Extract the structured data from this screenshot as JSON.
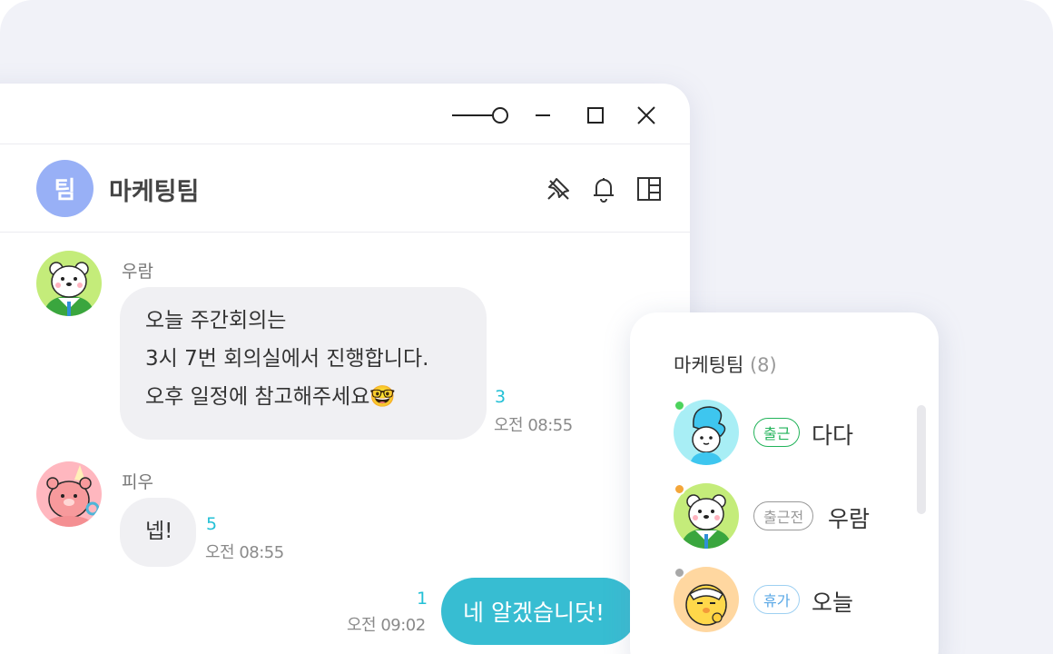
{
  "window_controls": {
    "slider_icon": "zoom-slider-icon",
    "minimize_icon": "minimize-icon",
    "maximize_icon": "maximize-icon",
    "close_icon": "close-icon"
  },
  "chat": {
    "avatar_text": "팀",
    "title": "마케팅팀",
    "header_icons": [
      "pin-icon",
      "bell-icon",
      "layout-panel-icon"
    ]
  },
  "messages": [
    {
      "sender": "우람",
      "lines": [
        "오늘 주간회의는",
        "3시 7번 회의실에서 진행합니다.",
        "오후 일정에 참고해주세요🤓"
      ],
      "read_count": "3",
      "time": "오전 08:55"
    },
    {
      "sender": "피우",
      "lines": [
        "넵!"
      ],
      "read_count": "5",
      "time": "오전 08:55"
    }
  ],
  "my_message": {
    "text": "네 알겠습니닷!",
    "read_count": "1",
    "time": "오전 09:02"
  },
  "member_panel": {
    "title": "마케팅팀",
    "count": "(8)",
    "members": [
      {
        "name": "다다",
        "status": "출근",
        "status_color": "#22b35a",
        "dot_color": "#4cd35c"
      },
      {
        "name": "우람",
        "status": "출근전",
        "status_color": "#999999",
        "dot_color": "#f4a63a"
      },
      {
        "name": "오늘",
        "status": "휴가",
        "status_color": "#5aa8e6",
        "dot_color": "#a8a8a8"
      }
    ]
  },
  "colors": {
    "accent": "#37bdd2",
    "team_avatar": "#98b0f6",
    "read_count": "#23c0d6"
  }
}
